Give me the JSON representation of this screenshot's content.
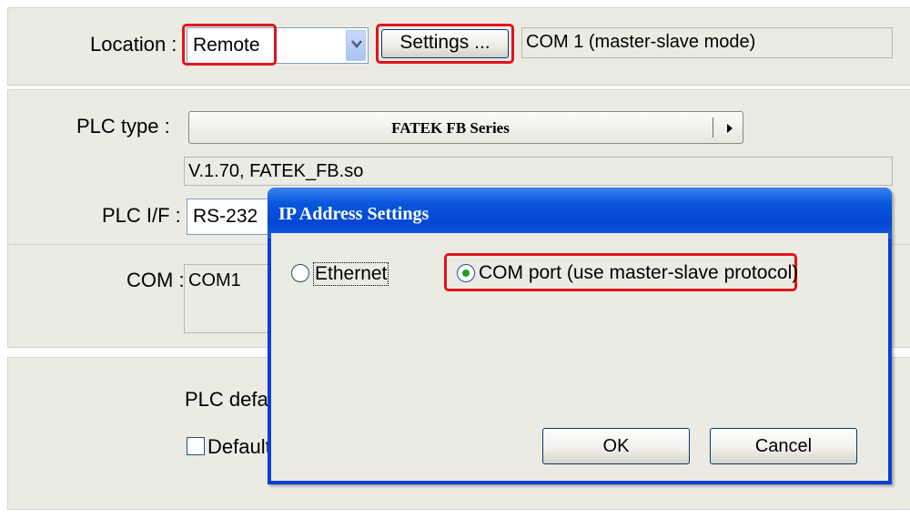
{
  "location": {
    "label": "Location :",
    "value": "Remote",
    "settings_button": "Settings ...",
    "status": "COM 1 (master-slave mode)"
  },
  "plc": {
    "type_label": "PLC type :",
    "type_value": "FATEK FB Series",
    "driver_info": "V.1.70, FATEK_FB.so",
    "if_label": "PLC I/F :",
    "if_value": "RS-232",
    "com_label": "COM :",
    "com_value": "COM1",
    "default_label": "PLC defau",
    "default_checkbox_label": "Default"
  },
  "dialog": {
    "title": "IP Address Settings",
    "option_ethernet": "Ethernet",
    "option_com": "COM port (use master-slave protocol)",
    "selected": "COM port",
    "ok": "OK",
    "cancel": "Cancel"
  },
  "colors": {
    "highlight": "#e0141e",
    "title_bar": "#0346d4",
    "panel": "#ecebe3"
  }
}
